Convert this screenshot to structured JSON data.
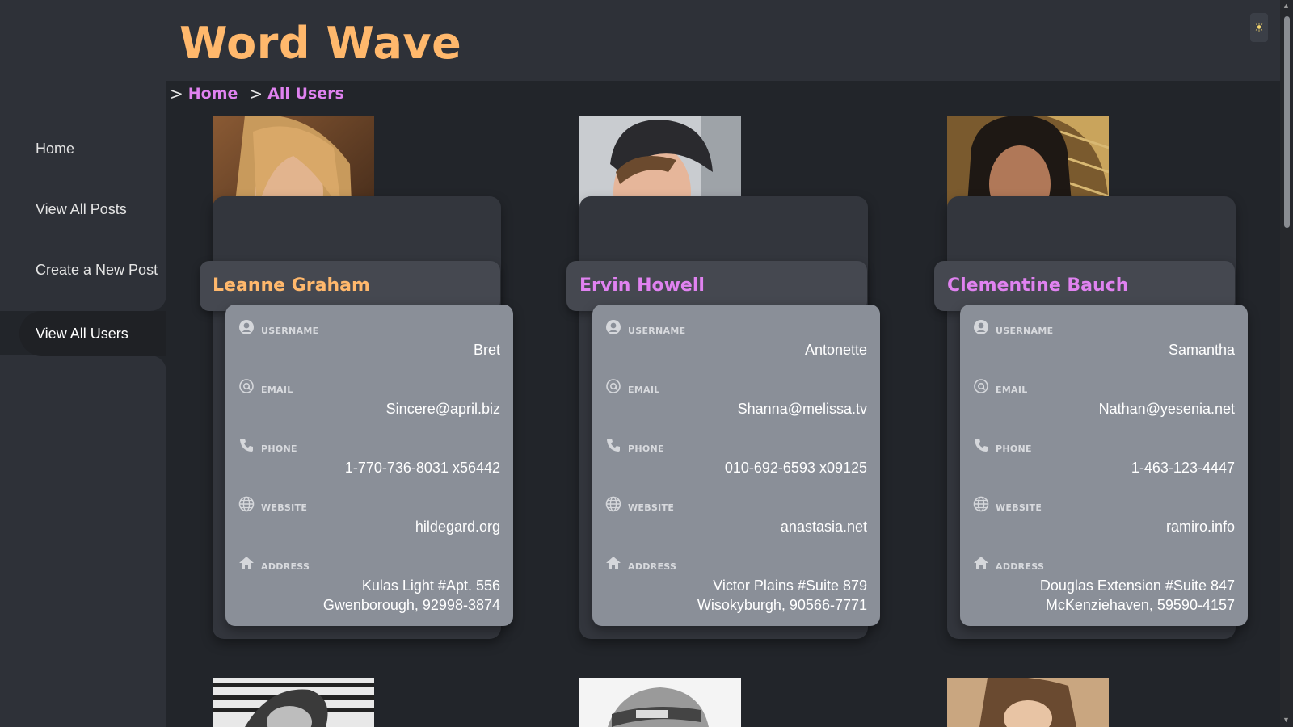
{
  "app": {
    "title": "Word Wave",
    "theme_icon": "sun-icon"
  },
  "breadcrumb": [
    "Home",
    "All Users"
  ],
  "sidebar": {
    "items": [
      {
        "label": "Home",
        "active": false
      },
      {
        "label": "View All Posts",
        "active": false
      },
      {
        "label": "Create a New Post",
        "active": false
      },
      {
        "label": "View All Users",
        "active": true
      }
    ]
  },
  "field_labels": {
    "username": "USERNAME",
    "email": "EMAIL",
    "phone": "PHONE",
    "website": "WEBSITE",
    "address": "ADDRESS"
  },
  "users": [
    {
      "name": "Leanne Graham",
      "name_color": "#ffb86c",
      "username": "Bret",
      "email": "Sincere@april.biz",
      "phone": "1-770-736-8031 x56442",
      "website": "hildegard.org",
      "address_line1": "Kulas Light #Apt. 556",
      "address_line2": "Gwenborough, 92998-3874"
    },
    {
      "name": "Ervin Howell",
      "name_color": "#e082f0",
      "username": "Antonette",
      "email": "Shanna@melissa.tv",
      "phone": "010-692-6593 x09125",
      "website": "anastasia.net",
      "address_line1": "Victor Plains #Suite 879",
      "address_line2": "Wisokyburgh, 90566-7771"
    },
    {
      "name": "Clementine Bauch",
      "name_color": "#e082f0",
      "username": "Samantha",
      "email": "Nathan@yesenia.net",
      "phone": "1-463-123-4447",
      "website": "ramiro.info",
      "address_line1": "Douglas Extension #Suite 847",
      "address_line2": "McKenziehaven, 59590-4157"
    }
  ],
  "colors": {
    "accent_orange": "#ffb86c",
    "accent_pink": "#e082f0",
    "panel": "#2e3138",
    "background": "#22252a"
  }
}
